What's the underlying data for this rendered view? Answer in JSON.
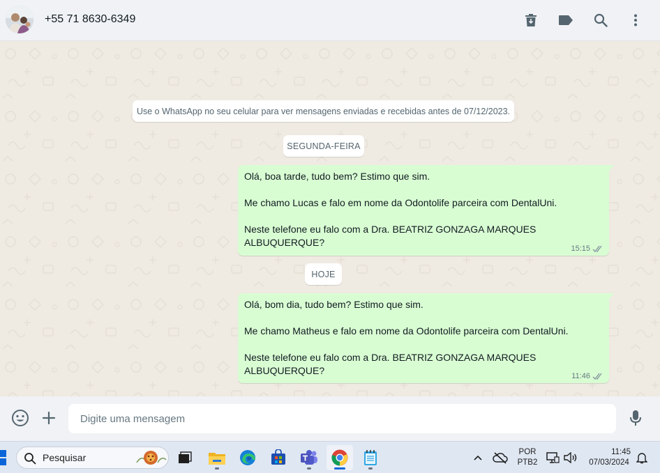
{
  "header": {
    "contact_name": "+55 71 8630-6349",
    "icons": [
      "delete-icon",
      "label-icon",
      "search-icon",
      "more-vert-icon"
    ]
  },
  "chat": {
    "notice": "Use o WhatsApp no seu celular para ver mensagens enviadas e recebidas antes de 07/12/2023.",
    "day_1": "SEGUNDA-FEIRA",
    "day_2": "HOJE",
    "messages": [
      {
        "lines": [
          "Olá, boa tarde, tudo bem? Estimo que sim.",
          "Me chamo Lucas e falo em nome da Odontolife parceira com DentalUni.",
          "Neste telefone eu falo com a Dra. BEATRIZ GONZAGA MARQUES ALBUQUERQUE?"
        ],
        "time": "15:15",
        "status": "delivered"
      },
      {
        "lines": [
          "Olá, bom dia, tudo bem? Estimo que sim.",
          "Me chamo Matheus e falo em nome da Odontolife parceira com DentalUni.",
          "Neste telefone eu falo com a Dra. BEATRIZ GONZAGA MARQUES ALBUQUERQUE?"
        ],
        "time": "11:46",
        "status": "delivered"
      }
    ]
  },
  "compose": {
    "placeholder": "Digite uma mensagem"
  },
  "taskbar": {
    "search_placeholder": "Pesquisar",
    "apps": [
      "file-explorer-icon",
      "edge-icon",
      "store-icon",
      "teams-icon",
      "chrome-icon",
      "notepad-icon"
    ],
    "language_line1": "POR",
    "language_line2": "PTB2",
    "time": "11:45",
    "date": "07/03/2024"
  },
  "colors": {
    "outgoing_bubble": "#d9fdd3",
    "chat_background": "#efeae2",
    "header_background": "#f0f2f5",
    "read_ticks": "#8696a0"
  }
}
